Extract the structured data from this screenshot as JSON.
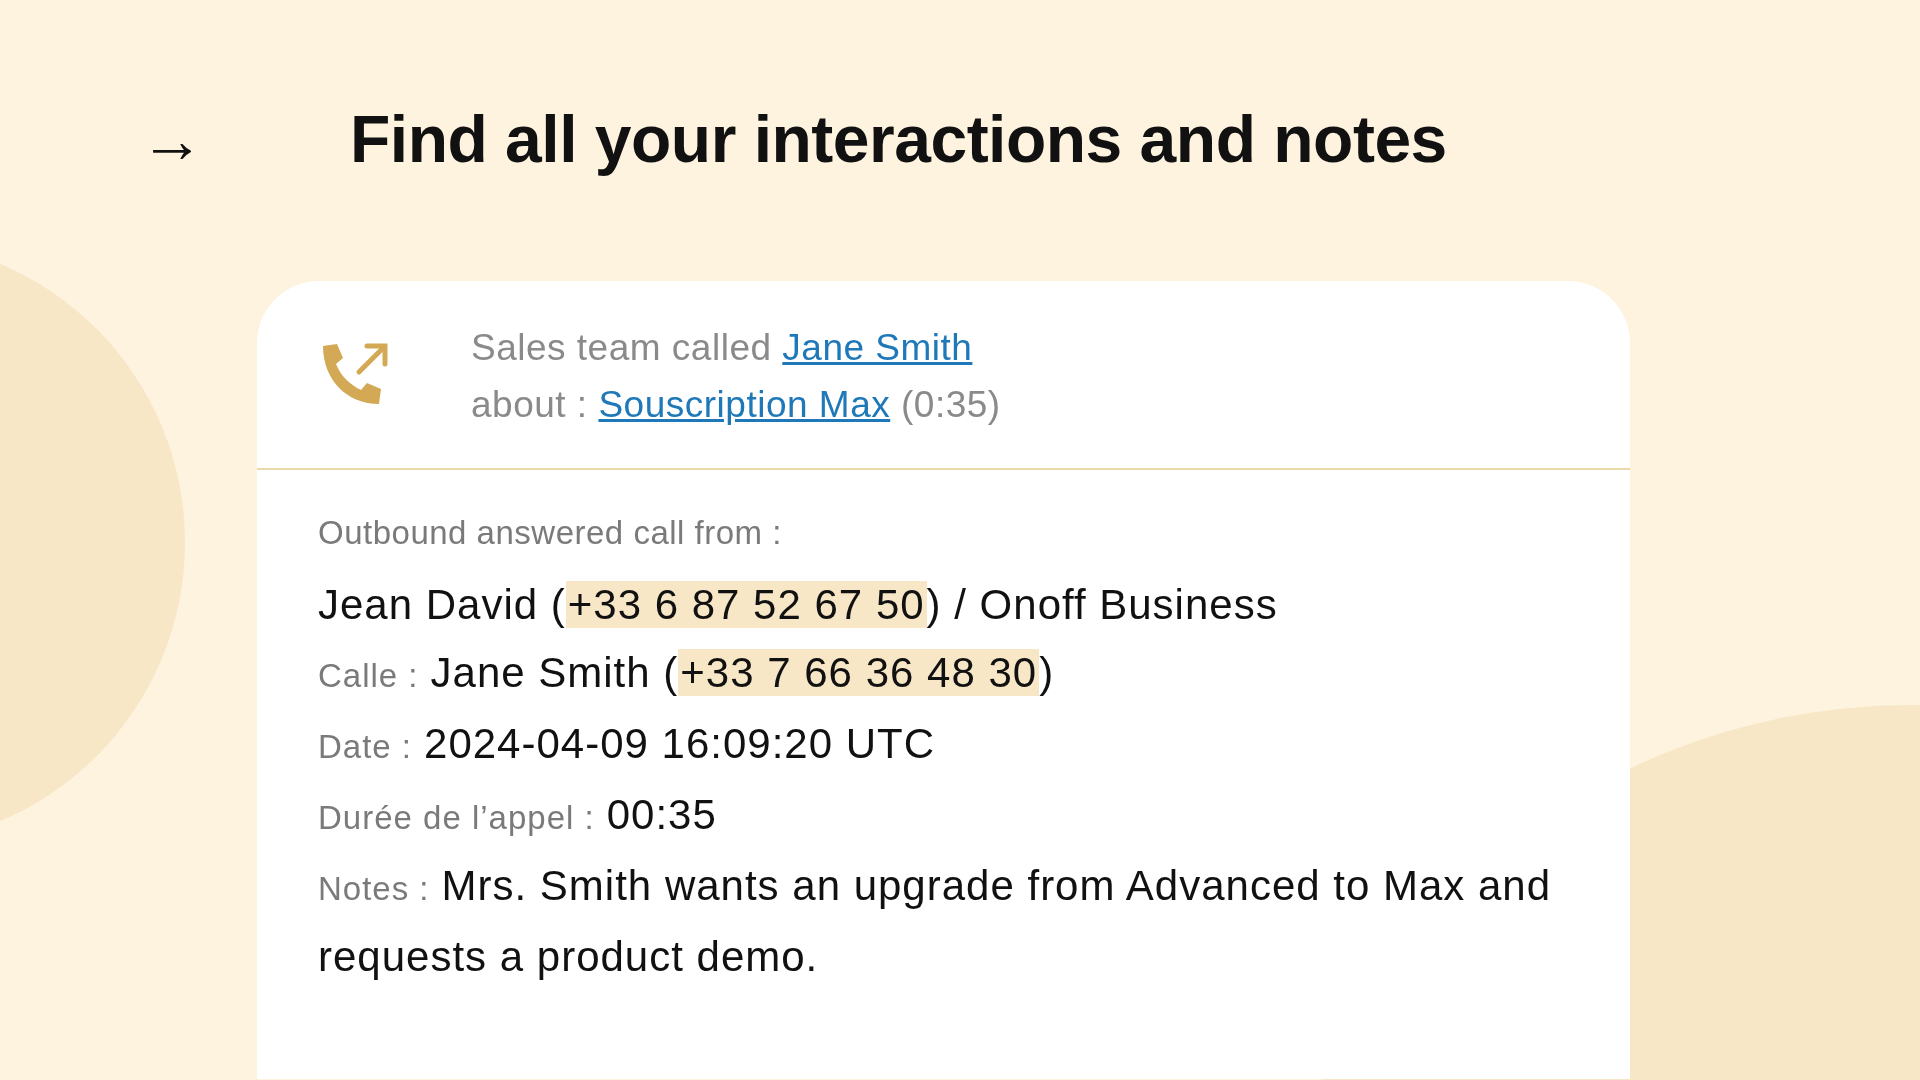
{
  "heading": {
    "arrow": "→",
    "title": "Find all your interactions and notes"
  },
  "call": {
    "summary_lines": [
      [
        {
          "text": "Sales team called ",
          "kind": "plain"
        },
        {
          "text": "Jane Smith",
          "kind": "link"
        }
      ],
      [
        {
          "text": "about : ",
          "kind": "plain"
        },
        {
          "text": "Souscription Max",
          "kind": "link"
        },
        {
          "text": " (0:35)",
          "kind": "plain"
        }
      ]
    ],
    "intro": "Outbound answered call from :",
    "fields": [
      {
        "segments": [
          {
            "text": "Jean David (",
            "highlight": false
          },
          {
            "text": "+33 6 87 52 67 50",
            "highlight": true
          },
          {
            "text": ") / Onoff Business",
            "highlight": false
          }
        ]
      },
      {
        "label": "Calle :",
        "segments": [
          {
            "text": "Jane Smith (",
            "highlight": false
          },
          {
            "text": "+33 7 66 36 48 30",
            "highlight": true
          },
          {
            "text": ")",
            "highlight": false
          }
        ]
      },
      {
        "label": "Date :",
        "segments": [
          {
            "text": "2024-04-09 16:09:20 UTC",
            "highlight": false
          }
        ]
      },
      {
        "label": "Durée de l’appel :",
        "segments": [
          {
            "text": "00:35",
            "highlight": false
          }
        ]
      },
      {
        "label": "Notes :",
        "segments": [
          {
            "text": "Mrs. Smith wants an upgrade from Advanced to Max and requests a product demo.",
            "highlight": false
          }
        ]
      }
    ]
  }
}
